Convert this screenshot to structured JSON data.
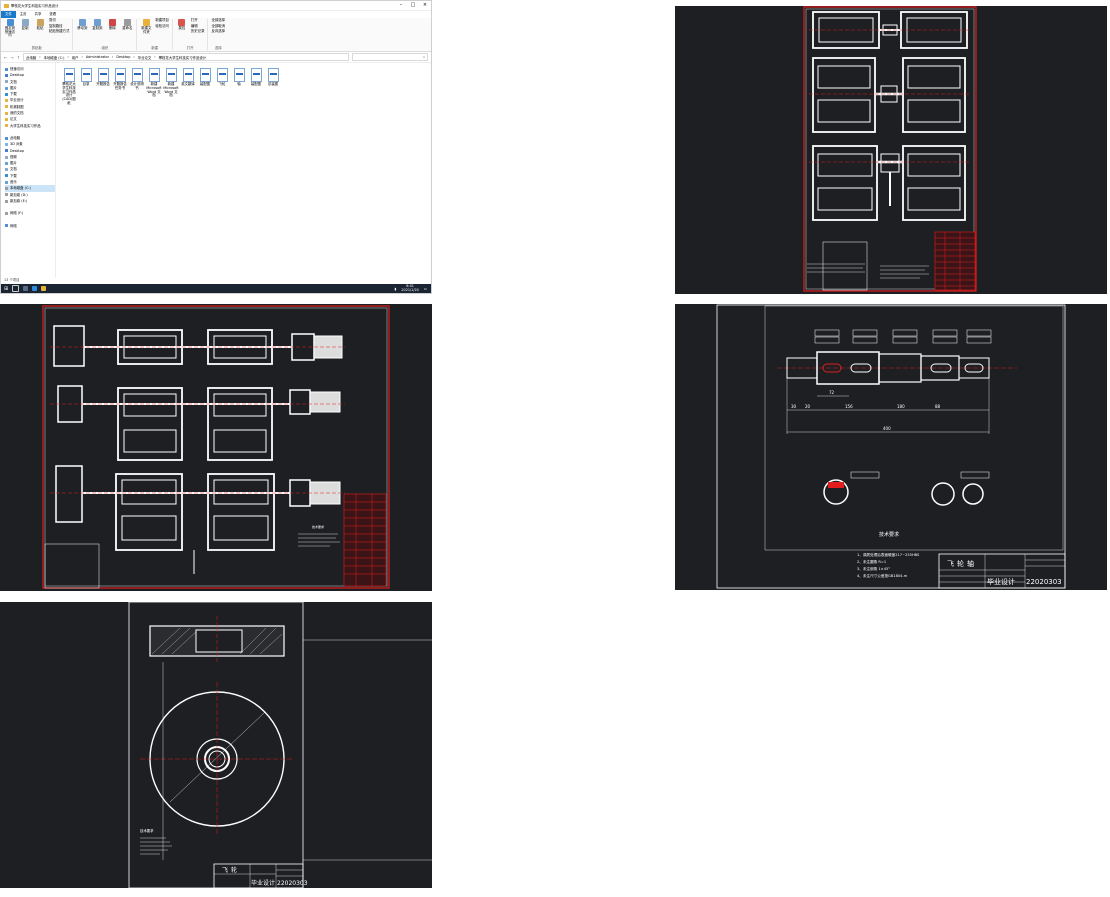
{
  "explorer": {
    "title": "攀枝花大学生科技实习作品设计",
    "ribbon_tabs": [
      "文件",
      "主页",
      "共享",
      "查看"
    ],
    "ribbon": {
      "groups": [
        {
          "label": "剪贴板",
          "items": [
            "固定到快速访问",
            "复制",
            "粘贴"
          ],
          "small": [
            "剪切",
            "复制路径",
            "粘贴快捷方式"
          ]
        },
        {
          "label": "组织",
          "items": [
            "移动到",
            "复制到",
            "删除",
            "重命名"
          ]
        },
        {
          "label": "新建",
          "items": [
            "新建文件夹"
          ],
          "small": [
            "新建项目",
            "轻松访问"
          ]
        },
        {
          "label": "打开",
          "items": [
            "属性"
          ],
          "small": [
            "打开",
            "编辑",
            "历史记录"
          ]
        },
        {
          "label": "选择",
          "items": [],
          "small": [
            "全部选择",
            "全部取消",
            "反向选择"
          ]
        }
      ]
    },
    "breadcrumb": [
      "此电脑",
      "本地磁盘 (C:)",
      "用户",
      "Administrator",
      "Desktop",
      "毕业论文",
      "攀枝花大学生科技实习作品设计"
    ],
    "search_placeholder": "搜索",
    "sidebar": [
      "快速访问",
      "Desktop",
      "文档",
      "图片",
      "下载",
      "毕业设计",
      "机械制图",
      "我的文档",
      "论文",
      "大学生科技实习作品",
      "",
      "此电脑",
      "3D 对象",
      "Desktop",
      "视频",
      "图片",
      "文档",
      "下载",
      "音乐",
      "本地磁盘 (C:)",
      "新加卷 (D:)",
      "新加卷 (E:)",
      "",
      "网络 (F:)",
      "",
      "网络"
    ],
    "files": [
      "攀枝花大学生科技实习作品设计(CAD)图纸",
      "目录",
      "开题报告",
      "开题报告任务书",
      "设计说明书",
      "新建 Microsoft Word 文档",
      "新建 Microsoft Word 文档",
      "英文翻译",
      "装配图",
      "飞轮",
      "轴",
      "装配图",
      "总装图"
    ],
    "status": "13 个项目",
    "clock_time": "8:41",
    "clock_date": "2021/1/20"
  },
  "shaft_drawing": {
    "tech_title": "技术要求",
    "tech_notes": [
      "1、调质处理后表面硬度217~255HBS",
      "2、未注圆角 R=1",
      "3、未注倒角 1×45°",
      "4、未注尺寸公差按GB1804-m"
    ],
    "part_name": "飞轮轴",
    "label": "毕业设计",
    "code": "22020303",
    "dims": [
      "30",
      "20",
      "72",
      "156",
      "180",
      "88",
      "400"
    ]
  },
  "flywheel_drawing": {
    "part_name": "飞轮",
    "label": "毕业设计",
    "code": "22020303",
    "notes_title": "技术要求"
  },
  "assembly_drawing": {
    "tech_title": "技术要求"
  },
  "colors": {
    "cad_bg": "#1d1f23",
    "cad_line": "#ffffff",
    "cad_red": "#e11d1d",
    "explorer_accent": "#1979ca"
  }
}
